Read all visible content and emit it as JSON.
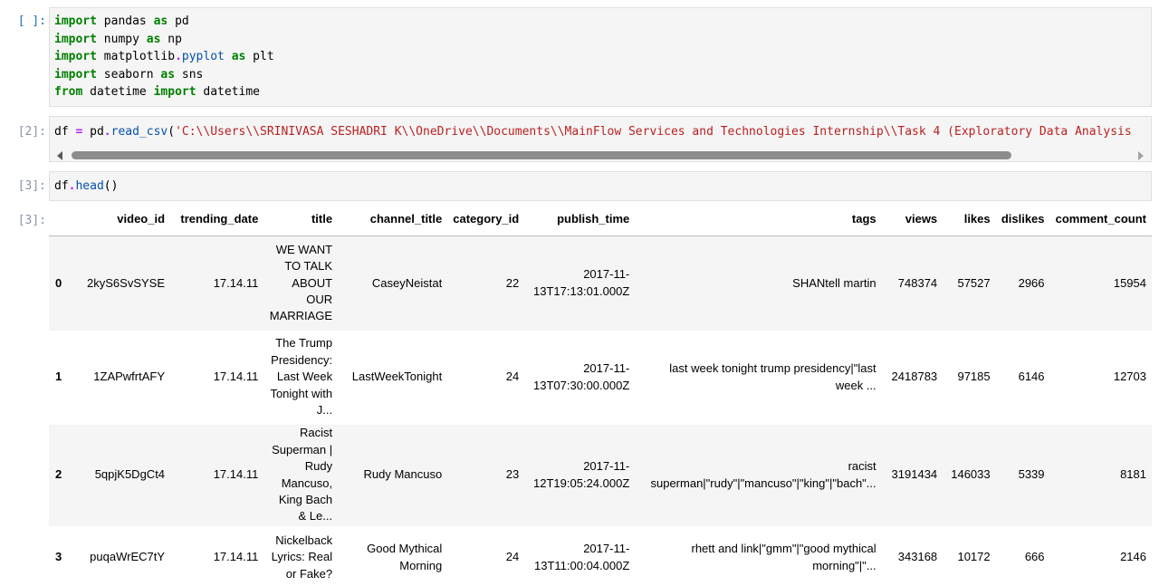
{
  "cells": [
    {
      "prompt": "[ ]:",
      "code_lines": [
        [
          [
            "kw",
            "import"
          ],
          [
            "plain",
            " pandas "
          ],
          [
            "kw",
            "as"
          ],
          [
            "plain",
            " pd"
          ]
        ],
        [
          [
            "kw",
            "import"
          ],
          [
            "plain",
            " numpy "
          ],
          [
            "kw",
            "as"
          ],
          [
            "plain",
            " np"
          ]
        ],
        [
          [
            "kw",
            "import"
          ],
          [
            "plain",
            " matplotlib"
          ],
          [
            "op",
            "."
          ],
          [
            "attr",
            "pyplot"
          ],
          [
            "plain",
            " "
          ],
          [
            "kw",
            "as"
          ],
          [
            "plain",
            " plt"
          ]
        ],
        [
          [
            "kw",
            "import"
          ],
          [
            "plain",
            " seaborn "
          ],
          [
            "kw",
            "as"
          ],
          [
            "plain",
            " sns"
          ]
        ],
        [
          [
            "kw",
            "from"
          ],
          [
            "plain",
            " datetime "
          ],
          [
            "kw",
            "import"
          ],
          [
            "plain",
            " datetime"
          ]
        ]
      ]
    },
    {
      "prompt": "[2]:",
      "code_lines": [
        [
          [
            "plain",
            "df "
          ],
          [
            "op",
            "="
          ],
          [
            "plain",
            " pd"
          ],
          [
            "op",
            "."
          ],
          [
            "attr",
            "read_csv"
          ],
          [
            "plain",
            "("
          ],
          [
            "str",
            "'C:\\\\Users\\\\SRINIVASA SESHADRI K\\\\OneDrive\\\\Documents\\\\MainFlow Services and Technologies Internship\\\\Task 4 (Exploratory Data Analysis"
          ]
        ]
      ]
    },
    {
      "prompt": "[3]:",
      "code_lines": [
        [
          [
            "plain",
            "df"
          ],
          [
            "op",
            "."
          ],
          [
            "attr",
            "head"
          ],
          [
            "plain",
            "()"
          ]
        ]
      ]
    }
  ],
  "output": {
    "prompt": "[3]:",
    "columns": [
      "",
      "video_id",
      "trending_date",
      "title",
      "channel_title",
      "category_id",
      "publish_time",
      "tags",
      "views",
      "likes",
      "dislikes",
      "comment_count"
    ],
    "rows": [
      [
        "0",
        "2kyS6SvSYSE",
        "17.14.11",
        "WE WANT TO TALK ABOUT OUR MARRIAGE",
        "CaseyNeistat",
        "22",
        "2017-11-13T17:13:01.000Z",
        "SHANtell martin",
        "748374",
        "57527",
        "2966",
        "15954"
      ],
      [
        "1",
        "1ZAPwfrtAFY",
        "17.14.11",
        "The Trump Presidency: Last Week Tonight with J...",
        "LastWeekTonight",
        "24",
        "2017-11-13T07:30:00.000Z",
        "last week tonight trump presidency|\"last week ...",
        "2418783",
        "97185",
        "6146",
        "12703"
      ],
      [
        "2",
        "5qpjK5DgCt4",
        "17.14.11",
        "Racist Superman | Rudy Mancuso, King Bach & Le...",
        "Rudy Mancuso",
        "23",
        "2017-11-12T19:05:24.000Z",
        "racist superman|\"rudy\"|\"mancuso\"|\"king\"|\"bach\"...",
        "3191434",
        "146033",
        "5339",
        "8181"
      ],
      [
        "3",
        "puqaWrEC7tY",
        "17.14.11",
        "Nickelback Lyrics: Real or Fake?",
        "Good Mythical Morning",
        "24",
        "2017-11-13T11:00:04.000Z",
        "rhett and link|\"gmm\"|\"good mythical morning\"|\"...",
        "343168",
        "10172",
        "666",
        "2146"
      ]
    ]
  },
  "colors": {
    "keyword": "#008000",
    "operator": "#aa22ff",
    "attribute": "#0550ae",
    "string": "#ba2121",
    "prompt": "#6b7c93",
    "cell_bg": "#f5f5f5"
  }
}
